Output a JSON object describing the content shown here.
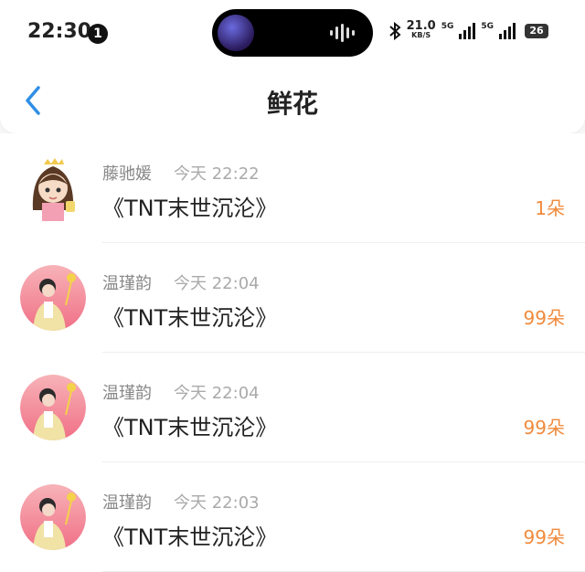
{
  "status": {
    "time": "22:30",
    "notification_count": "1",
    "net_speed_value": "21.0",
    "net_speed_unit": "KB/S",
    "signal1_label": "5G",
    "signal2_label": "5G",
    "battery": "26"
  },
  "nav": {
    "title": "鲜花"
  },
  "items": [
    {
      "name": "藤驰媛",
      "time": "今天 22:22",
      "book": "《TNT末世沉沦》",
      "count": "1朵",
      "avatar": "cartoon"
    },
    {
      "name": "温瑾韵",
      "time": "今天 22:04",
      "book": "《TNT末世沉沦》",
      "count": "99朵",
      "avatar": "photo"
    },
    {
      "name": "温瑾韵",
      "time": "今天 22:04",
      "book": "《TNT末世沉沦》",
      "count": "99朵",
      "avatar": "photo"
    },
    {
      "name": "温瑾韵",
      "time": "今天 22:03",
      "book": "《TNT末世沉沦》",
      "count": "99朵",
      "avatar": "photo"
    }
  ],
  "colors": {
    "accent_count": "#f08a3c",
    "back_arrow": "#2f8fe6"
  }
}
